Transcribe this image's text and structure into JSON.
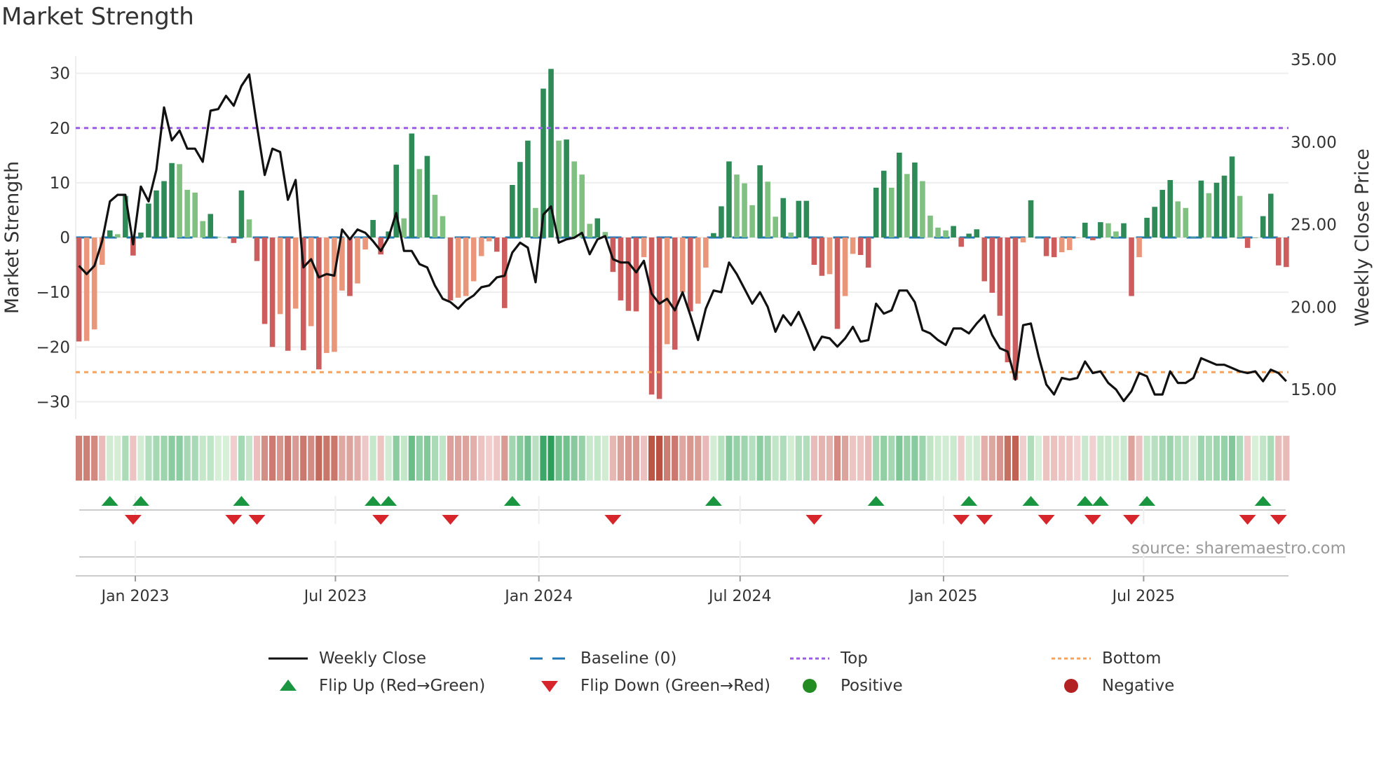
{
  "title": "Market Strength",
  "source": "source: sharemaestro.com",
  "colors": {
    "pos_rising": "#2e8b57",
    "pos_falling": "#80c080",
    "neg_falling": "#cd5c5c",
    "neg_rising": "#e9967a",
    "close": "#111111",
    "baseline": "#1f77b4",
    "top": "#9b5de5",
    "bottom": "#f4a460",
    "flip_up": "#1a9641",
    "flip_down": "#d7262b",
    "positive": "#228b22",
    "negative": "#b22222"
  },
  "legend": [
    {
      "label": "Weekly Close",
      "icon": "solid-line"
    },
    {
      "label": "Baseline (0)",
      "icon": "dashed-line"
    },
    {
      "label": "Top",
      "icon": "dotted-line-purple"
    },
    {
      "label": "Bottom",
      "icon": "dotted-line-orange"
    },
    {
      "label": "Flip Up (Red→Green)",
      "icon": "triangle-up"
    },
    {
      "label": "Flip Down (Green→Red)",
      "icon": "triangle-down"
    },
    {
      "label": "Positive",
      "icon": "circle-green"
    },
    {
      "label": "Negative",
      "icon": "circle-red"
    }
  ],
  "chart_data": {
    "type": "bar",
    "title": "Market Strength",
    "xlabel": "",
    "ylabel": "Market Strength",
    "y2label": "Weekly Close Price",
    "start_date": "2022-11-11",
    "frequency": "weekly",
    "ylim": [
      -33,
      33
    ],
    "y2lim": [
      13.9,
      35.9
    ],
    "yticks": [
      30,
      20,
      10,
      0,
      -10,
      -20,
      -30
    ],
    "ytick_labels": [
      "30",
      "20",
      "10",
      "0",
      "−10",
      "−20",
      "−30"
    ],
    "y2ticks": [
      35,
      30,
      25,
      20,
      15
    ],
    "y2tick_labels": [
      "35.00",
      "30.00",
      "25.00",
      "20.00",
      "15.00"
    ],
    "xticks": [
      {
        "date": "2023-01-01",
        "label": "Jan 2023"
      },
      {
        "date": "2023-07-01",
        "label": "Jul 2023"
      },
      {
        "date": "2024-01-01",
        "label": "Jan 2024"
      },
      {
        "date": "2024-07-01",
        "label": "Jul 2024"
      },
      {
        "date": "2025-01-01",
        "label": "Jan 2025"
      },
      {
        "date": "2025-07-01",
        "label": "Jul 2025"
      }
    ],
    "top_level": 20,
    "bottom_level": -24.6,
    "baseline": 0,
    "grid": true,
    "legend_position": "bottom",
    "strength": [
      -19,
      -18.9,
      -16.8,
      -5,
      1.3,
      0.6,
      7.6,
      -3.3,
      0.9,
      6.2,
      8.6,
      10.3,
      13.6,
      13.4,
      8.7,
      8.2,
      3,
      4.3,
      0.1,
      0,
      -1,
      8.6,
      3.3,
      -4.3,
      -15.8,
      -20,
      -14,
      -20.7,
      -13,
      -20.6,
      -16.2,
      -24.1,
      -21.1,
      -20.9,
      -9.7,
      -10.7,
      -8.4,
      -2.2,
      3.2,
      -3.1,
      1.1,
      13.3,
      3.5,
      19,
      12.5,
      14.9,
      7.8,
      3.9,
      -11.5,
      -11,
      -10.7,
      -8,
      -3.4,
      -0.7,
      -2.6,
      -12.9,
      9.6,
      13.8,
      17.7,
      5.4,
      27.2,
      30.8,
      17.7,
      17.9,
      13.9,
      11.5,
      2.5,
      3.5,
      1,
      -6.3,
      -11.5,
      -13.4,
      -13.5,
      -3.6,
      -28.7,
      -29.5,
      -19.5,
      -20.5,
      -10,
      -13.5,
      -12.1,
      -5.5,
      0.8,
      5.7,
      13.9,
      11.5,
      9.9,
      5.9,
      13.2,
      10.2,
      3.8,
      7.2,
      0.9,
      6.7,
      6.7,
      -5,
      -7,
      -6.7,
      -16.7,
      -10.7,
      -3,
      -3.2,
      -5.5,
      9.1,
      12.2,
      9.1,
      15.5,
      11.6,
      13.7,
      10.3,
      4,
      1.8,
      1.3,
      2.1,
      -1.7,
      0.7,
      1.5,
      -8,
      -10.1,
      -14.3,
      -22.8,
      -26,
      -0.9,
      6.8,
      0,
      -3.4,
      -3.6,
      -2.7,
      -2.3,
      -0.1,
      2.7,
      -0.5,
      2.8,
      2.6,
      1.1,
      2.6,
      -10.7,
      -3.6,
      3.6,
      5.6,
      8.7,
      10.5,
      6.6,
      5.4,
      0.1,
      10.4,
      8.1,
      10,
      11.3,
      14.8,
      7.6,
      -1.9,
      0,
      3.9,
      8,
      -5.1,
      -5.4
    ],
    "close": [
      22.5,
      22.0,
      22.5,
      24.0,
      26.4,
      26.8,
      26.8,
      23.8,
      27.3,
      26.4,
      28.3,
      32.1,
      30.1,
      30.7,
      29.6,
      29.6,
      28.8,
      31.9,
      32.0,
      32.8,
      32.2,
      33.4,
      34.1,
      31.0,
      28.0,
      29.6,
      29.4,
      26.5,
      27.7,
      22.4,
      22.9,
      21.8,
      22.0,
      21.9,
      24.7,
      24.1,
      24.7,
      24.5,
      24.0,
      23.4,
      24.2,
      25.7,
      23.4,
      23.4,
      22.6,
      22.4,
      21.3,
      20.5,
      20.3,
      19.9,
      20.4,
      20.7,
      21.2,
      21.3,
      21.8,
      21.9,
      23.3,
      23.9,
      23.6,
      21.5,
      25.6,
      26.1,
      23.9,
      24.1,
      24.2,
      24.5,
      23.2,
      24.1,
      24.3,
      22.9,
      22.7,
      22.7,
      22.1,
      22.8,
      20.8,
      20.2,
      20.5,
      19.8,
      20.9,
      19.5,
      18.0,
      19.9,
      21.0,
      20.9,
      22.7,
      22.0,
      21.1,
      20.2,
      20.9,
      20.0,
      18.5,
      19.5,
      18.9,
      19.7,
      18.6,
      17.4,
      18.2,
      18.1,
      17.6,
      18.1,
      18.8,
      17.9,
      18.0,
      20.2,
      19.6,
      19.8,
      21.0,
      21.0,
      20.3,
      18.6,
      18.4,
      18.0,
      17.7,
      18.7,
      18.7,
      18.4,
      19.0,
      19.5,
      18.3,
      17.5,
      17.3,
      15.6,
      18.9,
      19.0,
      17.0,
      15.3,
      14.7,
      15.7,
      15.6,
      15.7,
      16.7,
      16.0,
      16.1,
      15.4,
      15.0,
      14.3,
      14.9,
      16.0,
      15.8,
      14.7,
      14.7,
      16.1,
      15.4,
      15.4,
      15.7,
      16.9,
      16.7,
      16.5,
      16.5,
      16.3,
      16.1,
      16.0,
      16.1,
      15.5,
      16.2,
      16.0,
      15.5
    ],
    "flip_up_weeks": [
      4,
      8,
      21,
      38,
      40,
      56,
      82,
      103,
      115,
      123,
      130,
      132,
      138,
      153
    ],
    "flip_down_weeks": [
      7,
      20,
      23,
      39,
      48,
      69,
      95,
      114,
      117,
      125,
      131,
      136,
      151,
      155
    ]
  }
}
